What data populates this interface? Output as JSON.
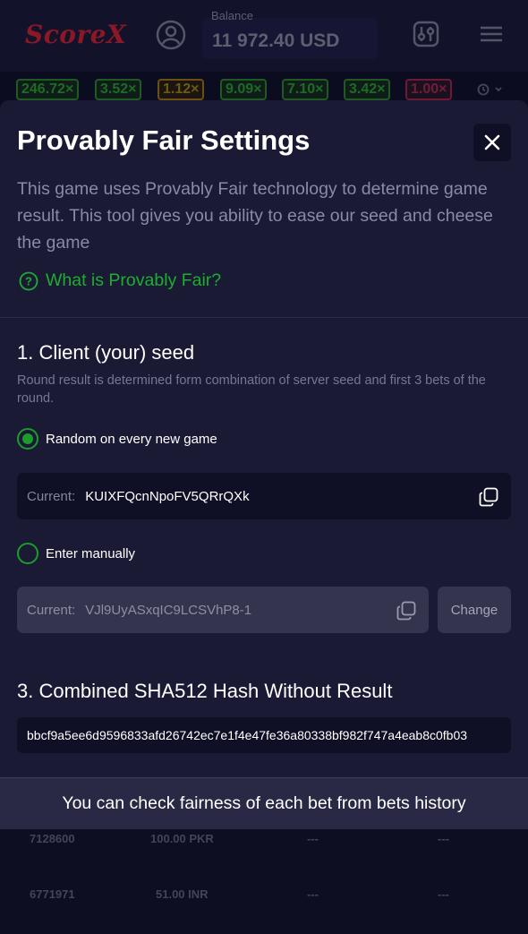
{
  "header": {
    "logo": "ScoreX",
    "balance_label": "Balance",
    "balance_value": "11 972.40 USD",
    "icons": [
      "user-avatar-icon",
      "settings-sliders-icon",
      "hamburger-menu-icon"
    ]
  },
  "multipliers": [
    {
      "value": "246.72×",
      "tone": "green"
    },
    {
      "value": "3.52×",
      "tone": "green"
    },
    {
      "value": "1.12×",
      "tone": "gold"
    },
    {
      "value": "9.09×",
      "tone": "green"
    },
    {
      "value": "7.10×",
      "tone": "green"
    },
    {
      "value": "3.42×",
      "tone": "green"
    },
    {
      "value": "1.00×",
      "tone": "red"
    }
  ],
  "modal": {
    "title": "Provably Fair Settings",
    "intro": "This game uses Provably Fair technology to determine game result. This tool gives you ability to ease our seed and cheese the game",
    "what_link": "What is Provably Fair?",
    "client_seed": {
      "title": "1. Client (your) seed",
      "description": "Round result is determined form combination of server seed and first 3 bets of the round.",
      "option_random": "Random on every new game",
      "current_label": "Current:",
      "random_value": "KUIXFQcnNpoFV5QRrQXk",
      "option_manual": "Enter manually",
      "manual_value": "VJl9UyASxqIC9LCSVhP8-1",
      "change_label": "Change"
    },
    "hash": {
      "title": "3. Combined SHA512 Hash Without Result",
      "value": "bbcf9a5ee6d9596833afd26742ec7e1f4e47fe36a80338bf982f747a4eab8c0fb03"
    }
  },
  "toast": "You can check fairness of each bet from bets history",
  "bets_rows": [
    {
      "id": "7128600",
      "amount": "100.00 PKR",
      "mult": "---",
      "win": "---"
    },
    {
      "id": "6771971",
      "amount": "51.00 INR",
      "mult": "---",
      "win": "---"
    }
  ],
  "colors": {
    "accent_green": "#1cae2f",
    "modal_bg": "#1a1a35",
    "field_bg": "#0f0f25"
  }
}
